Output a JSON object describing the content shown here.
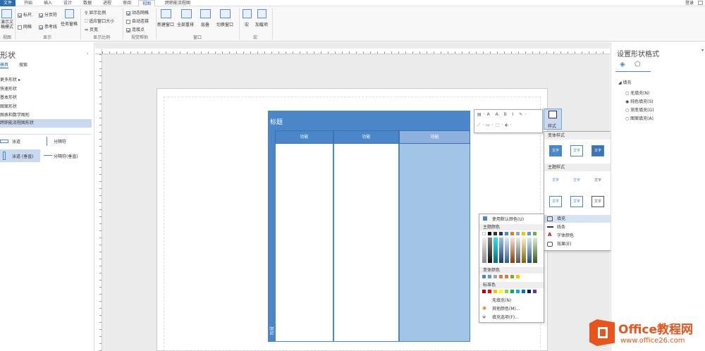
{
  "ribbon": {
    "tabs": [
      "文件",
      "开始",
      "插入",
      "设计",
      "数据",
      "进程",
      "审阅",
      "视图",
      "跨职能流程图"
    ],
    "active_tab": "视图",
    "login": "登录",
    "groups": {
      "view": {
        "label": "视图",
        "big_button": "演示文稿模式"
      },
      "show": {
        "label": "显示",
        "ruler": "标尺",
        "pagebreaks": "分页符",
        "grid": "网格",
        "guides": "参考线",
        "taskpane": "任务窗格"
      },
      "zoom": {
        "label": "显示比例",
        "zoom": "显示比例",
        "fitwindow": "适应窗口大小",
        "pagewidth": "页宽"
      },
      "visual": {
        "label": "视觉帮助",
        "dynamic_grid": "动态网格",
        "autoconnect": "自动连接",
        "connection_points": "连接点"
      },
      "window": {
        "label": "窗口",
        "new_window": "新建窗口",
        "arrange_all": "全部重排",
        "cascade": "层叠",
        "switch_windows": "切换窗口"
      },
      "macros": {
        "label": "宏",
        "macros": "宏",
        "addons": "加载项"
      }
    }
  },
  "left_pane": {
    "title": "形状",
    "tab_stencils": "模具",
    "tab_search": "搜索",
    "items": [
      "更多形状",
      "快速形状",
      "基本形状",
      "图案形状",
      "图表和数学图形",
      "跨职能流程图形状"
    ],
    "shapes": [
      "泳道",
      "分隔符",
      "泳道 (垂直)",
      "分隔符(垂直)"
    ]
  },
  "swimlane": {
    "title": "标题",
    "columns": [
      "功能",
      "功能",
      "功能"
    ],
    "phase": "阶段"
  },
  "right_pane": {
    "title": "设置形状格式",
    "section": "填充",
    "options": [
      "无填充(N)",
      "纯色填充(S)",
      "渐变填充(G)",
      "图案填充(A)"
    ],
    "selected_option": "纯色填充(S)"
  },
  "mini_toolbar": {
    "style_label": "样式"
  },
  "style_menu": {
    "variant_header": "变体样式",
    "theme_header": "主题样式",
    "tile_text": "文字",
    "items": [
      "填充",
      "线条",
      "字体颜色",
      "效果(E)"
    ]
  },
  "fill_menu": {
    "auto": "使用默认颜色(U)",
    "theme_header": "主题颜色",
    "variant_header": "变体颜色",
    "standard_header": "标准色",
    "no_fill": "无填充(N)",
    "more_colors": "其他颜色(M)...",
    "fill_options": "填充选项(F)..."
  },
  "watermark": {
    "brand": "Office教程网",
    "url": "www.office26.com"
  },
  "colors": {
    "accent": "#4a86c8",
    "lane_highlight": "#a2c4e6",
    "header_dark": "#4a86c8"
  }
}
